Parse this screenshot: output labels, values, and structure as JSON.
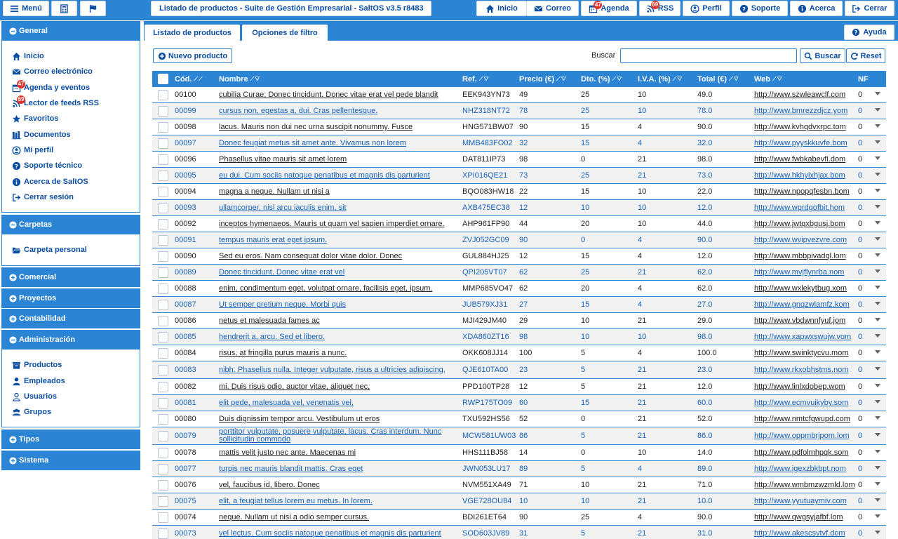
{
  "topbar": {
    "menu_label": "Menú",
    "title": "Listado de productos - Suite de Gestión Empresarial - SaltOS v3.5 r8483",
    "inicio_label": "Inicio",
    "correo_label": "Correo",
    "agenda_label": "Agenda",
    "agenda_badge": "47",
    "rss_label": "RSS",
    "rss_badge": "69",
    "perfil_label": "Perfil",
    "soporte_label": "Soporte",
    "acerca_label": "Acerca",
    "cerrar_label": "Cerrar"
  },
  "sidebar": {
    "general": {
      "title": "General",
      "items": [
        {
          "label": "Inicio",
          "icon": "home-icon"
        },
        {
          "label": "Correo electrónico",
          "icon": "envelope-icon"
        },
        {
          "label": "Agenda y eventos",
          "icon": "calendar-icon",
          "badge": "47"
        },
        {
          "label": "Lector de feeds RSS",
          "icon": "rss-icon",
          "badge": "69"
        },
        {
          "label": "Favoritos",
          "icon": "star-icon"
        },
        {
          "label": "Documentos",
          "icon": "books-icon"
        },
        {
          "label": "Mi perfil",
          "icon": "user-circle-icon"
        },
        {
          "label": "Soporte técnico",
          "icon": "question-icon"
        },
        {
          "label": "Acerca de SaltOS",
          "icon": "info-icon"
        },
        {
          "label": "Cerrar sesión",
          "icon": "sign-out-icon"
        }
      ]
    },
    "carpetas": {
      "title": "Carpetas",
      "items": [
        {
          "label": "Carpeta personal",
          "icon": "folder-open-icon"
        }
      ]
    },
    "comercial": {
      "title": "Comercial"
    },
    "proyectos": {
      "title": "Proyectos"
    },
    "contabilidad": {
      "title": "Contabilidad"
    },
    "administracion": {
      "title": "Administración",
      "items": [
        {
          "label": "Productos",
          "icon": "archive-icon"
        },
        {
          "label": "Empleados",
          "icon": "user-icon"
        },
        {
          "label": "Usuarios",
          "icon": "user-outline-icon"
        },
        {
          "label": "Grupos",
          "icon": "users-icon"
        }
      ]
    },
    "tipos": {
      "title": "Tipos"
    },
    "sistema": {
      "title": "Sistema"
    }
  },
  "main": {
    "tabs": [
      {
        "label": "Listado de productos"
      },
      {
        "label": "Opciones de filtro"
      }
    ],
    "help_label": "Ayuda",
    "new_label": "Nuevo producto",
    "search_label": "Buscar",
    "search_value": "",
    "search_btn": "Buscar",
    "reset_btn": "Reset",
    "columns": {
      "cod": "Cód.",
      "nombre": "Nombre",
      "ref": "Ref.",
      "precio": "Precio (€)",
      "dto": "Dto. (%)",
      "iva": "I.V.A. (%)",
      "total": "Total (€)",
      "web": "Web",
      "nf": "NF"
    },
    "rows": [
      {
        "cod": "00100",
        "nombre": "cubilia Curae; Donec tincidunt. Donec vitae erat vel pede blandit",
        "ref": "EEK943YN73",
        "precio": "49",
        "dto": "25",
        "iva": "10",
        "total": "49.0",
        "web": "http://www.szwleawclf.com",
        "nf": "0"
      },
      {
        "cod": "00099",
        "nombre": "cursus non, egestas a, dui. Cras pellentesque.",
        "ref": "NHZ318NT72",
        "precio": "78",
        "dto": "25",
        "iva": "10",
        "total": "78.0",
        "web": "http://www.bmrezzdjcz.yom",
        "nf": "0"
      },
      {
        "cod": "00098",
        "nombre": "lacus. Mauris non dui nec urna suscipit nonummy. Fusce",
        "ref": "HNG571BW07",
        "precio": "90",
        "dto": "15",
        "iva": "4",
        "total": "90.0",
        "web": "http://www.kvhqdvxrpc.tom",
        "nf": "0"
      },
      {
        "cod": "00097",
        "nombre": "Donec feugiat metus sit amet ante. Vivamus non lorem",
        "ref": "MMB483FO02",
        "precio": "32",
        "dto": "15",
        "iva": "4",
        "total": "32.0",
        "web": "http://www.pyyskkuvfe.bom",
        "nf": "0"
      },
      {
        "cod": "00096",
        "nombre": "Phasellus vitae mauris sit amet lorem",
        "ref": "DAT811IP73",
        "precio": "98",
        "dto": "0",
        "iva": "21",
        "total": "98.0",
        "web": "http://www.fwbkabevfi.dom",
        "nf": "0"
      },
      {
        "cod": "00095",
        "nombre": "eu dui. Cum sociis natoque penatibus et magnis dis parturient",
        "ref": "XPI016QE21",
        "precio": "73",
        "dto": "25",
        "iva": "21",
        "total": "73.0",
        "web": "http://www.hkhyixhjax.bom",
        "nf": "0"
      },
      {
        "cod": "00094",
        "nombre": "magna a neque. Nullam ut nisi a",
        "ref": "BQO083HW18",
        "precio": "22",
        "dto": "15",
        "iva": "10",
        "total": "22.0",
        "web": "http://www.npopqfesbn.bom",
        "nf": "0"
      },
      {
        "cod": "00093",
        "nombre": "ullamcorper, nisl arcu iaculis enim, sit",
        "ref": "AXB475EC38",
        "precio": "12",
        "dto": "10",
        "iva": "10",
        "total": "12.0",
        "web": "http://www.wprdgofbit.hom",
        "nf": "0"
      },
      {
        "cod": "00092",
        "nombre": "inceptos hymenaeos. Mauris ut quam vel sapien imperdiet ornare.",
        "ref": "AHP961FP90",
        "precio": "44",
        "dto": "20",
        "iva": "10",
        "total": "44.0",
        "web": "http://www.jwtqxbgusj.bom",
        "nf": "0"
      },
      {
        "cod": "00091",
        "nombre": "tempus mauris erat eget ipsum.",
        "ref": "ZVJ052GC09",
        "precio": "90",
        "dto": "0",
        "iva": "4",
        "total": "90.0",
        "web": "http://www.wvipvezvre.com",
        "nf": "0"
      },
      {
        "cod": "00090",
        "nombre": "Sed eu eros. Nam consequat dolor vitae dolor. Donec",
        "ref": "GUL884HJ25",
        "precio": "12",
        "dto": "15",
        "iva": "4",
        "total": "12.0",
        "web": "http://www.mbbpivadql.lom",
        "nf": "0"
      },
      {
        "cod": "00089",
        "nombre": "Donec tincidunt. Donec vitae erat vel",
        "ref": "QPI205VT07",
        "precio": "62",
        "dto": "25",
        "iva": "21",
        "total": "62.0",
        "web": "http://www.mvjflynrba.nom",
        "nf": "0"
      },
      {
        "cod": "00088",
        "nombre": "enim, condimentum eget, volutpat ornare, facilisis eget, ipsum.",
        "ref": "MMP685VO47",
        "precio": "62",
        "dto": "20",
        "iva": "4",
        "total": "62.0",
        "web": "http://www.wxlekytbug.xom",
        "nf": "0"
      },
      {
        "cod": "00087",
        "nombre": "Ut semper pretium neque. Morbi quis",
        "ref": "JUB579XJ31",
        "precio": "27",
        "dto": "15",
        "iva": "4",
        "total": "27.0",
        "web": "http://www.gnqzwlamfz.kom",
        "nf": "0"
      },
      {
        "cod": "00086",
        "nombre": "netus et malesuada fames ac",
        "ref": "MJI429JM40",
        "precio": "29",
        "dto": "10",
        "iva": "21",
        "total": "29.0",
        "web": "http://www.vbdwnnfyuf.jom",
        "nf": "0"
      },
      {
        "cod": "00085",
        "nombre": "hendrerit a, arcu. Sed et libero.",
        "ref": "XDA860ZT16",
        "precio": "98",
        "dto": "10",
        "iva": "10",
        "total": "98.0",
        "web": "http://www.xapwxswujw.vom",
        "nf": "0"
      },
      {
        "cod": "00084",
        "nombre": "risus, at fringilla purus mauris a nunc.",
        "ref": "OKK608JJ14",
        "precio": "100",
        "dto": "5",
        "iva": "4",
        "total": "100.0",
        "web": "http://www.swinktycvu.mom",
        "nf": "0"
      },
      {
        "cod": "00083",
        "nombre": "nibh. Phasellus nulla. Integer vulputate, risus a ultricies adipiscing,",
        "ref": "QJE610TA00",
        "precio": "23",
        "dto": "5",
        "iva": "21",
        "total": "23.0",
        "web": "http://www.rkxobhstms.nom",
        "nf": "0"
      },
      {
        "cod": "00082",
        "nombre": "mi. Duis risus odio, auctor vitae, aliquet nec,",
        "ref": "PPD100TP28",
        "precio": "12",
        "dto": "5",
        "iva": "21",
        "total": "12.0",
        "web": "http://www.linlxdobep.wom",
        "nf": "0"
      },
      {
        "cod": "00081",
        "nombre": "elit pede, malesuada vel, venenatis vel,",
        "ref": "RWP175TO09",
        "precio": "60",
        "dto": "15",
        "iva": "21",
        "total": "60.0",
        "web": "http://www.ecmvuikyby.som",
        "nf": "0"
      },
      {
        "cod": "00080",
        "nombre": "Duis dignissim tempor arcu. Vestibulum ut eros",
        "ref": "TXU592HS56",
        "precio": "52",
        "dto": "0",
        "iva": "21",
        "total": "52.0",
        "web": "http://www.nmtcfgwupd.com",
        "nf": "0"
      },
      {
        "cod": "00079",
        "nombre": "porttitor vulputate, posuere vulputate, lacus. Cras interdum. Nunc sollicitudin commodo",
        "ref": "MCW581UW03",
        "precio": "86",
        "dto": "5",
        "iva": "21",
        "total": "86.0",
        "web": "http://www.oppmbrjpom.lom",
        "nf": "0"
      },
      {
        "cod": "00078",
        "nombre": "mattis velit justo nec ante. Maecenas mi",
        "ref": "HHS111BJ58",
        "precio": "14",
        "dto": "0",
        "iva": "10",
        "total": "14.0",
        "web": "http://www.pdfolmhpqk.som",
        "nf": "0"
      },
      {
        "cod": "00077",
        "nombre": "turpis nec mauris blandit mattis. Cras eget",
        "ref": "JWN053LU17",
        "precio": "89",
        "dto": "5",
        "iva": "4",
        "total": "89.0",
        "web": "http://www.igexzbkbpt.nom",
        "nf": "0"
      },
      {
        "cod": "00076",
        "nombre": "vel, faucibus id, libero. Donec",
        "ref": "NVM551XA49",
        "precio": "71",
        "dto": "10",
        "iva": "21",
        "total": "71.0",
        "web": "http://www.wmbmzwzmld.lom",
        "nf": "0"
      },
      {
        "cod": "00075",
        "nombre": "elit, a feugiat tellus lorem eu metus. In lorem.",
        "ref": "VGE728OU84",
        "precio": "10",
        "dto": "10",
        "iva": "21",
        "total": "10.0",
        "web": "http://www.yyutuaymiv.com",
        "nf": "0"
      },
      {
        "cod": "00074",
        "nombre": "neque. Nullam ut nisi a odio semper cursus.",
        "ref": "BDI261ET64",
        "precio": "90",
        "dto": "25",
        "iva": "4",
        "total": "90.0",
        "web": "http://www.qwgsyjafbf.lom",
        "nf": "0"
      },
      {
        "cod": "00073",
        "nombre": "vel lectus. Cum sociis natoque penatibus et magnis dis parturient",
        "ref": "SOD603JV89",
        "precio": "31",
        "dto": "5",
        "iva": "21",
        "total": "31.0",
        "web": "http://www.akescsvtvf.dom",
        "nf": "0"
      }
    ]
  },
  "colors": {
    "accent": "#2c84d4",
    "link": "#0b4ea2",
    "badge": "#e0332b",
    "row_alt": "#f2f2f2"
  }
}
